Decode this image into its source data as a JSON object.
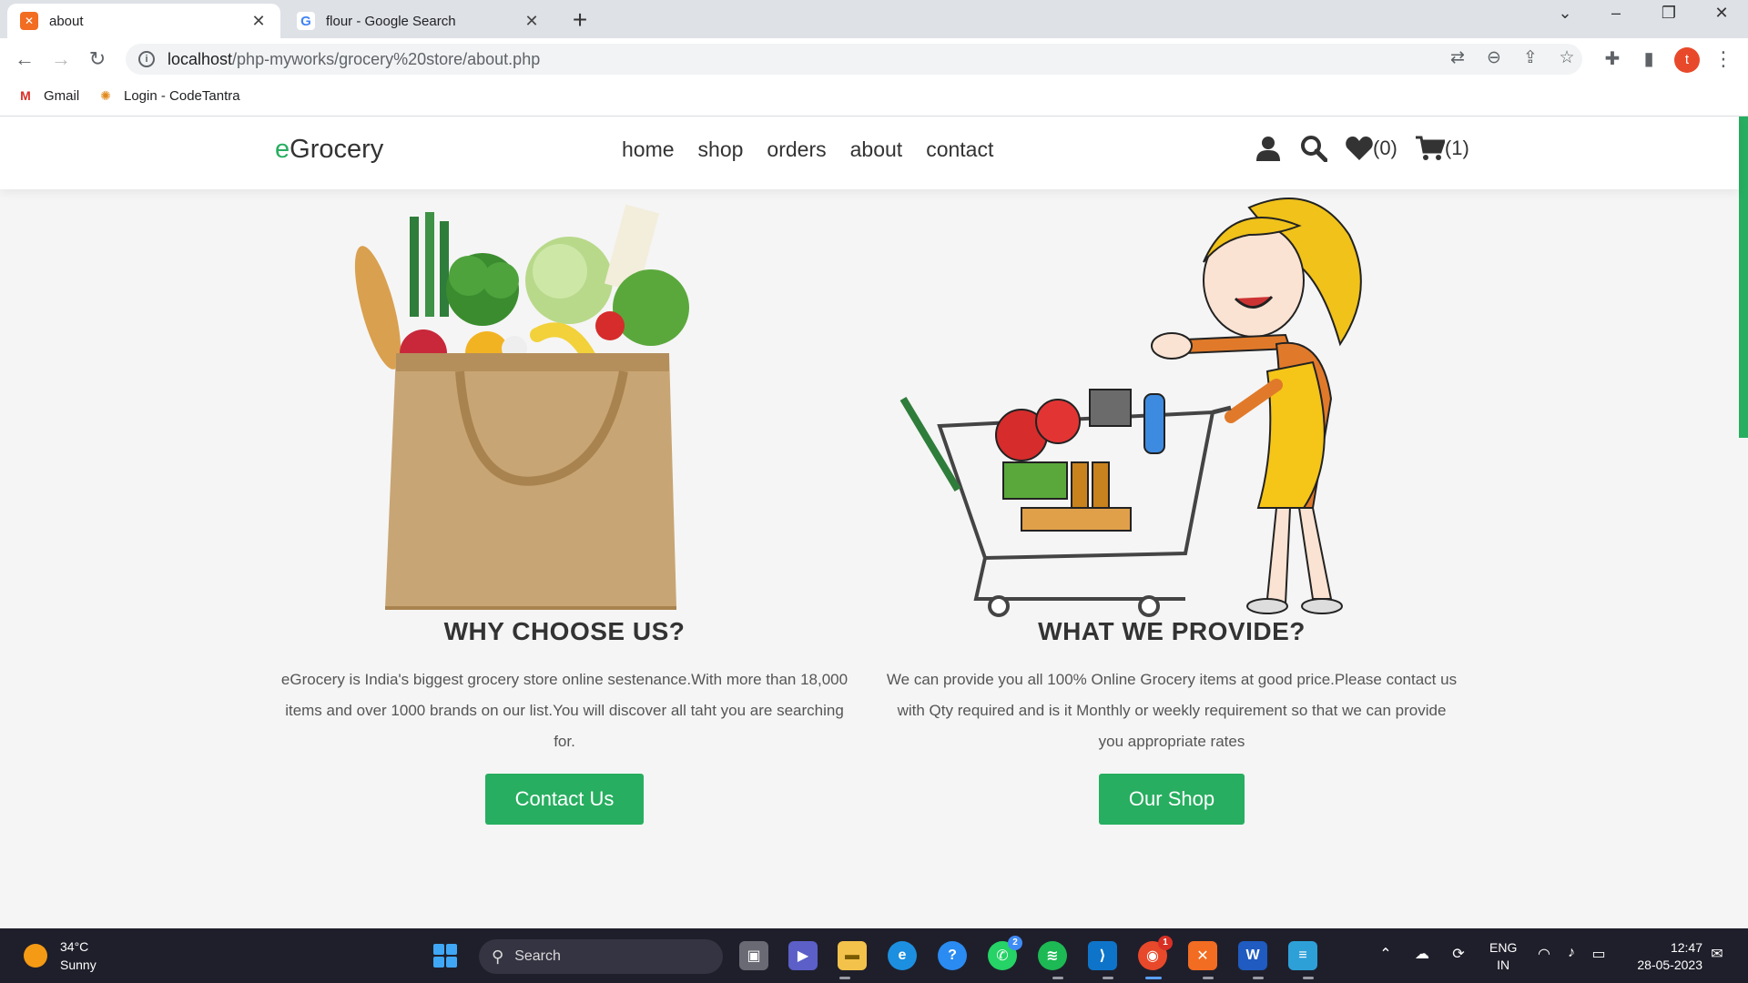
{
  "browser": {
    "tabs": [
      {
        "title": "about",
        "favicon": "xampp-icon"
      },
      {
        "title": "flour - Google Search",
        "favicon": "google-icon"
      }
    ],
    "url_host": "localhost",
    "url_path": "/php-myworks/grocery%20store/about.php",
    "profile_initial": "t",
    "bookmarks": [
      {
        "label": "Gmail",
        "icon": "gmail-icon"
      },
      {
        "label": "Login - CodeTantra",
        "icon": "codetantra-icon"
      }
    ]
  },
  "site": {
    "logo_prefix": "e",
    "logo_rest": "Grocery",
    "nav": [
      "home",
      "shop",
      "orders",
      "about",
      "contact"
    ],
    "wishlist_count": "(0)",
    "cart_count": "(1)",
    "accent": "#27ae60"
  },
  "sections": {
    "left": {
      "heading": "WHY CHOOSE US?",
      "text": "eGrocery is India's biggest grocery store online sestenance.With more than 18,000 items and over 1000 brands on our list.You will discover all taht you are searching for.",
      "button": "Contact Us"
    },
    "right": {
      "heading": "WHAT WE PROVIDE?",
      "text": "We can provide you all 100% Online Grocery items at good price.Please contact us with Qty required and is it Monthly or weekly requirement so that we can provide you appropriate rates",
      "button": "Our Shop"
    }
  },
  "taskbar": {
    "weather_temp": "34°C",
    "weather_desc": "Sunny",
    "search_label": "Search",
    "whatsapp_badge": "2",
    "chrome_badge": "1",
    "lang_top": "ENG",
    "lang_bottom": "IN",
    "time": "12:47",
    "date": "28-05-2023"
  }
}
